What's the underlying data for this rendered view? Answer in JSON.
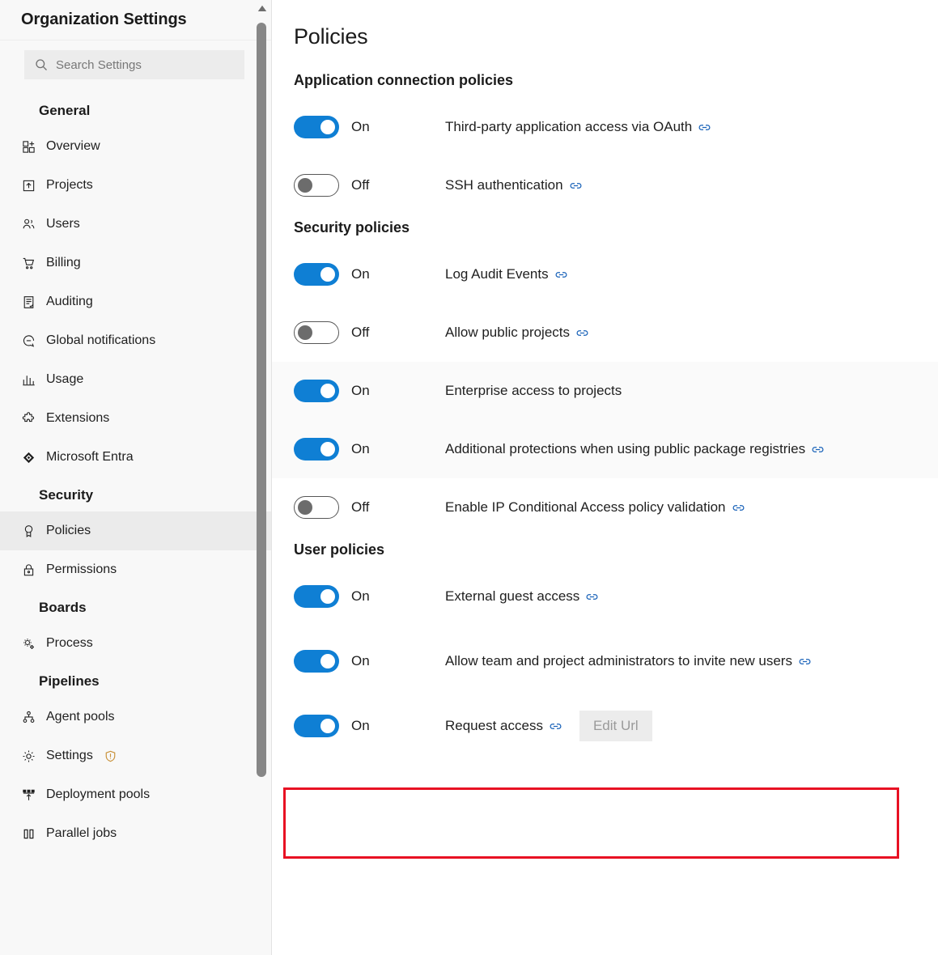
{
  "sidebar": {
    "title": "Organization Settings",
    "search": {
      "placeholder": "Search Settings",
      "value": "",
      "icon": "search-icon"
    },
    "scrollbar": {
      "up_arrow_icon": "caret-up-icon"
    },
    "groups": [
      {
        "title": "General",
        "items": [
          {
            "label": "Overview",
            "icon": "overview-icon",
            "selected": false
          },
          {
            "label": "Projects",
            "icon": "projects-icon",
            "selected": false
          },
          {
            "label": "Users",
            "icon": "users-icon",
            "selected": false
          },
          {
            "label": "Billing",
            "icon": "billing-cart-icon",
            "selected": false
          },
          {
            "label": "Auditing",
            "icon": "auditing-icon",
            "selected": false
          },
          {
            "label": "Global notifications",
            "icon": "global-notifications-icon",
            "selected": false
          },
          {
            "label": "Usage",
            "icon": "usage-chart-icon",
            "selected": false
          },
          {
            "label": "Extensions",
            "icon": "extensions-puzzle-icon",
            "selected": false
          },
          {
            "label": "Microsoft Entra",
            "icon": "microsoft-entra-icon",
            "selected": false
          }
        ]
      },
      {
        "title": "Security",
        "items": [
          {
            "label": "Policies",
            "icon": "policies-ribbon-icon",
            "selected": true
          },
          {
            "label": "Permissions",
            "icon": "permissions-lock-icon",
            "selected": false
          }
        ]
      },
      {
        "title": "Boards",
        "items": [
          {
            "label": "Process",
            "icon": "process-gears-icon",
            "selected": false
          }
        ]
      },
      {
        "title": "Pipelines",
        "items": [
          {
            "label": "Agent pools",
            "icon": "agent-pools-icon",
            "selected": false
          },
          {
            "label": "Settings",
            "icon": "settings-gear-icon",
            "selected": false,
            "badge": "warning-shield-icon"
          },
          {
            "label": "Deployment pools",
            "icon": "deployment-pools-icon",
            "selected": false
          },
          {
            "label": "Parallel jobs",
            "icon": "parallel-jobs-icon",
            "selected": false
          }
        ]
      }
    ]
  },
  "main": {
    "page_title": "Policies",
    "sections": [
      {
        "title": "Application connection policies",
        "policies": [
          {
            "state": "On",
            "on": true,
            "label": "Third-party application access via OAuth",
            "has_link": true,
            "shaded": false
          },
          {
            "state": "Off",
            "on": false,
            "label": "SSH authentication",
            "has_link": true,
            "shaded": false
          }
        ]
      },
      {
        "title": "Security policies",
        "policies": [
          {
            "state": "On",
            "on": true,
            "label": "Log Audit Events",
            "has_link": true,
            "shaded": false
          },
          {
            "state": "Off",
            "on": false,
            "label": "Allow public projects",
            "has_link": true,
            "shaded": false
          },
          {
            "state": "On",
            "on": true,
            "label": "Enterprise access to projects",
            "has_link": false,
            "shaded": true
          },
          {
            "state": "On",
            "on": true,
            "label": "Additional protections when using public package registries",
            "has_link": true,
            "shaded": true
          },
          {
            "state": "Off",
            "on": false,
            "label": "Enable IP Conditional Access policy validation",
            "has_link": true,
            "shaded": false
          }
        ]
      },
      {
        "title": "User policies",
        "policies": [
          {
            "state": "On",
            "on": true,
            "label": "External guest access",
            "has_link": true,
            "shaded": false
          },
          {
            "state": "On",
            "on": true,
            "label": "Allow team and project administrators to invite new users",
            "has_link": true,
            "shaded": false,
            "highlighted": true
          },
          {
            "state": "On",
            "on": true,
            "label": "Request access",
            "has_link": true,
            "shaded": false,
            "button": "Edit Url"
          }
        ]
      }
    ]
  },
  "annotation": {
    "color": "#e81123"
  },
  "colors": {
    "accent_blue": "#0f7fd4",
    "link_blue": "#1660b8",
    "annotation_red": "#e81123",
    "sidebar_bg": "#f8f8f8",
    "selected_bg": "#ebebeb",
    "warning_amber": "#c9923a"
  }
}
